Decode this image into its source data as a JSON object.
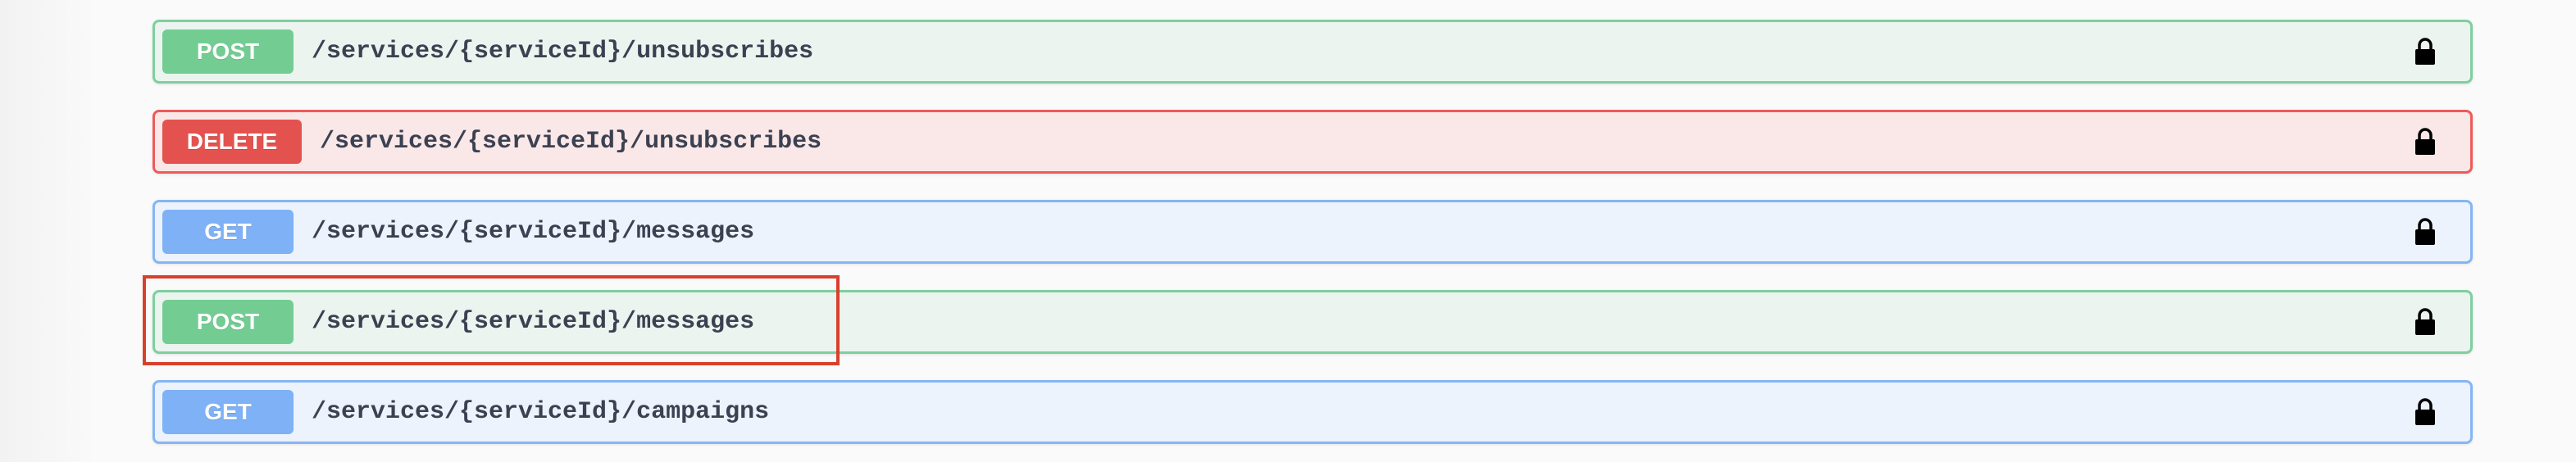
{
  "endpoints": [
    {
      "method": "POST",
      "method_class": "post",
      "path": "/services/{serviceId}/unsubscribes",
      "lock_icon": "lock-icon"
    },
    {
      "method": "DELETE",
      "method_class": "delete",
      "path": "/services/{serviceId}/unsubscribes",
      "lock_icon": "lock-icon"
    },
    {
      "method": "GET",
      "method_class": "get",
      "path": "/services/{serviceId}/messages",
      "lock_icon": "lock-icon"
    },
    {
      "method": "POST",
      "method_class": "post",
      "path": "/services/{serviceId}/messages",
      "lock_icon": "lock-icon",
      "highlighted": true
    },
    {
      "method": "GET",
      "method_class": "get",
      "path": "/services/{serviceId}/campaigns",
      "lock_icon": "lock-icon"
    }
  ],
  "colors": {
    "post_bg": "#ebf4ef",
    "post_border": "#7fcf9f",
    "post_badge": "#73cd93",
    "delete_bg": "#fae7e7",
    "delete_border": "#ee5a5a",
    "delete_badge": "#e4524f",
    "get_bg": "#ecf3fd",
    "get_border": "#86b5f4",
    "get_badge": "#7eb1f5",
    "highlight_border": "#d9402c",
    "path_text": "#3b4151"
  }
}
